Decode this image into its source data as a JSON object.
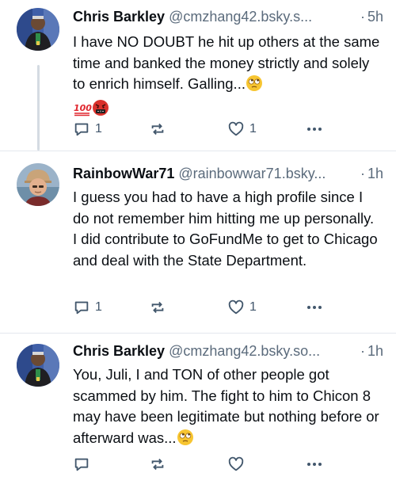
{
  "posts": [
    {
      "author_name": "Chris Barkley",
      "handle": "@cmzhang42.bsky.s...",
      "separator": "·",
      "time": "5h",
      "text": "I have NO DOUBT he hit up others at the same time and banked the money strictly and solely to enrich himself. Galling...",
      "emojis": [
        "face-with-rolling-eyes",
        "hundred-points",
        "face-with-symbols-on-mouth"
      ],
      "reply_count": "1",
      "like_count": "1"
    },
    {
      "author_name": "RainbowWar71",
      "handle": "@rainbowwar71.bsky...",
      "separator": "·",
      "time": "1h",
      "text": "I guess you had to have a high profile since I do not remember him hitting me up personally. I did contribute to GoFundMe to get to Chicago and deal with the State Department.",
      "reply_count": "1",
      "like_count": "1"
    },
    {
      "author_name": "Chris Barkley",
      "handle": "@cmzhang42.bsky.so...",
      "separator": "·",
      "time": "1h",
      "text": "You, Juli, I and TON of other people got scammed by him. The fight to him to Chicon 8 may have been legitimate but nothing before or afterward was...",
      "emojis": [
        "face-with-rolling-eyes"
      ],
      "reply_count": "",
      "like_count": ""
    }
  ],
  "colors": {
    "text": "#0b0f14",
    "muted": "#5b6b7c",
    "icon": "#42576c",
    "thread_line": "#d4dbe2",
    "divider": "#e4e8ee"
  },
  "icons": [
    "reply-icon",
    "repost-icon",
    "like-icon",
    "more-icon"
  ]
}
